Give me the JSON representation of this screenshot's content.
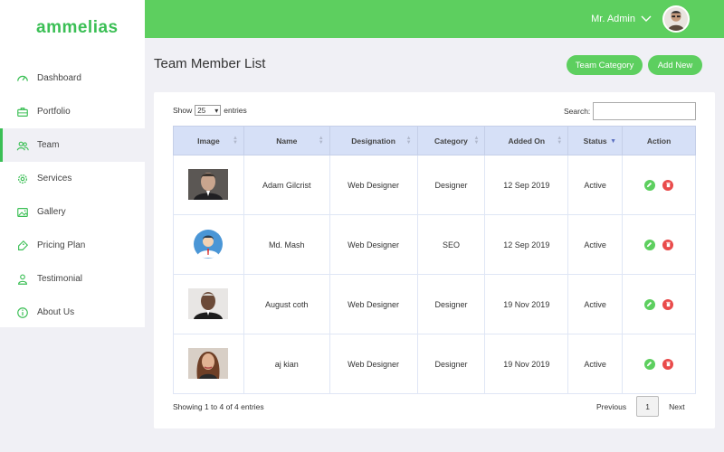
{
  "brand": "ammelias",
  "header": {
    "admin_name": "Mr. Admin"
  },
  "sidebar": {
    "items": [
      {
        "label": "Dashboard",
        "icon": "speedometer-icon"
      },
      {
        "label": "Portfolio",
        "icon": "briefcase-icon"
      },
      {
        "label": "Team",
        "icon": "users-icon",
        "active": true
      },
      {
        "label": "Services",
        "icon": "gear-icon"
      },
      {
        "label": "Gallery",
        "icon": "image-icon"
      },
      {
        "label": "Pricing Plan",
        "icon": "tag-icon"
      },
      {
        "label": "Testimonial",
        "icon": "user-icon"
      },
      {
        "label": "About Us",
        "icon": "info-icon"
      }
    ]
  },
  "page": {
    "title": "Team Member List",
    "team_category_label": "Team Category",
    "add_new_label": "Add New"
  },
  "table_controls": {
    "show_label": "Show",
    "entries_value": "25",
    "entries_label": "entries",
    "search_label": "Search:"
  },
  "table": {
    "columns": [
      "Image",
      "Name",
      "Designation",
      "Category",
      "Added On",
      "Status",
      "Action"
    ],
    "rows": [
      {
        "name": "Adam Gilcrist",
        "designation": "Web Designer",
        "category": "Designer",
        "added_on": "12 Sep 2019",
        "status": "Active",
        "photo": "photo"
      },
      {
        "name": "Md. Mash",
        "designation": "Web Designer",
        "category": "SEO",
        "added_on": "12 Sep 2019",
        "status": "Active",
        "photo": "avatar-placeholder"
      },
      {
        "name": "August coth",
        "designation": "Web Designer",
        "category": "Designer",
        "added_on": "19 Nov 2019",
        "status": "Active",
        "photo": "photo"
      },
      {
        "name": "aj kian",
        "designation": "Web Designer",
        "category": "Designer",
        "added_on": "19 Nov 2019",
        "status": "Active",
        "photo": "photo"
      }
    ]
  },
  "footer": {
    "info": "Showing 1 to 4 of 4 entries",
    "previous": "Previous",
    "page": "1",
    "next": "Next"
  },
  "colors": {
    "accent": "#5dcf5f",
    "brand_text": "#3bbf55",
    "danger": "#e94b4b",
    "table_header": "#d6e0f7"
  }
}
